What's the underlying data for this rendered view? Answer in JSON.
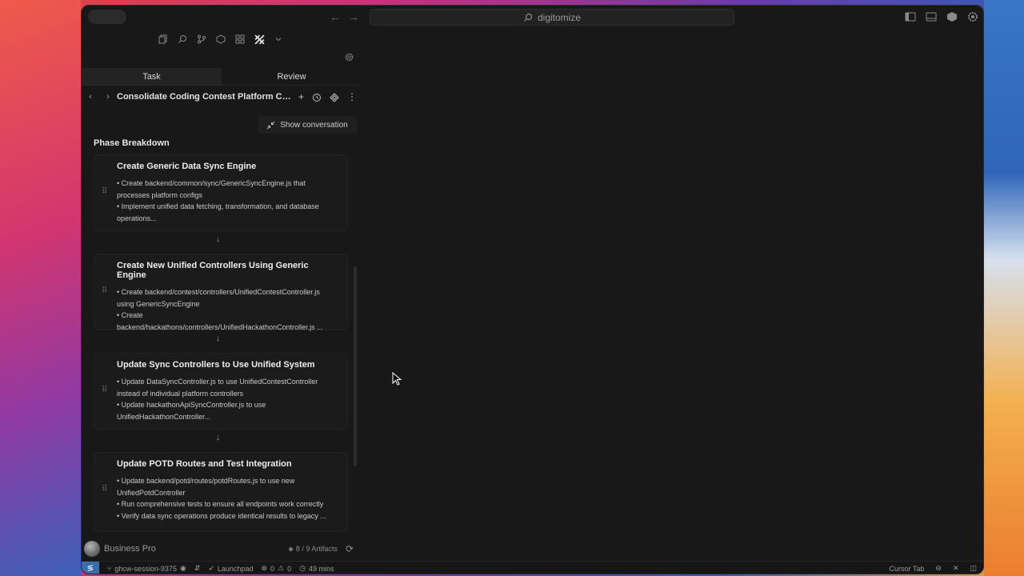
{
  "window": {
    "search_text": "digitomize"
  },
  "panel": {
    "tabs": [
      {
        "label": "Task"
      },
      {
        "label": "Review"
      }
    ],
    "task_title": "Consolidate Coding Contest Platform Cont...",
    "show_conversation_label": "Show conversation",
    "phase_heading": "Phase Breakdown",
    "phases": [
      {
        "title": "Create Generic Data Sync Engine",
        "lines": [
          "• Create backend/common/sync/GenericSyncEngine.js that",
          "processes platform configs",
          "• Implement unified data fetching, transformation, and database",
          "operations..."
        ]
      },
      {
        "title": "Create New Unified Controllers Using Generic Engine",
        "lines": [
          "• Create backend/contest/controllers/UnifiedContestController.js",
          "using GenericSyncEngine",
          "• Create",
          "backend/hackathons/controllers/UnifiedHackathonController.js ..."
        ]
      },
      {
        "title": "Update Sync Controllers to Use Unified System",
        "lines": [
          "• Update DataSyncController.js to use UnifiedContestController",
          "instead of individual platform controllers",
          "• Update hackathonApiSyncController.js to use",
          "UnifiedHackathonController..."
        ]
      },
      {
        "title": "Update POTD Routes and Test Integration",
        "lines": [
          "• Update backend/potd/routes/potdRoutes.js to use new",
          "UnifiedPotdController",
          "• Run comprehensive tests to ensure all endpoints work correctly",
          "• Verify data sync operations produce identical results to legacy ..."
        ]
      }
    ],
    "footer": {
      "plan": "Business Pro",
      "artifacts": "8 / 9 Artifacts"
    }
  },
  "statusbar": {
    "branch": "ghcw-session-9375",
    "launchpad": "Launchpad",
    "errors": "0",
    "warnings": "0",
    "time": "49 mins",
    "cursor_tab": "Cursor Tab"
  }
}
